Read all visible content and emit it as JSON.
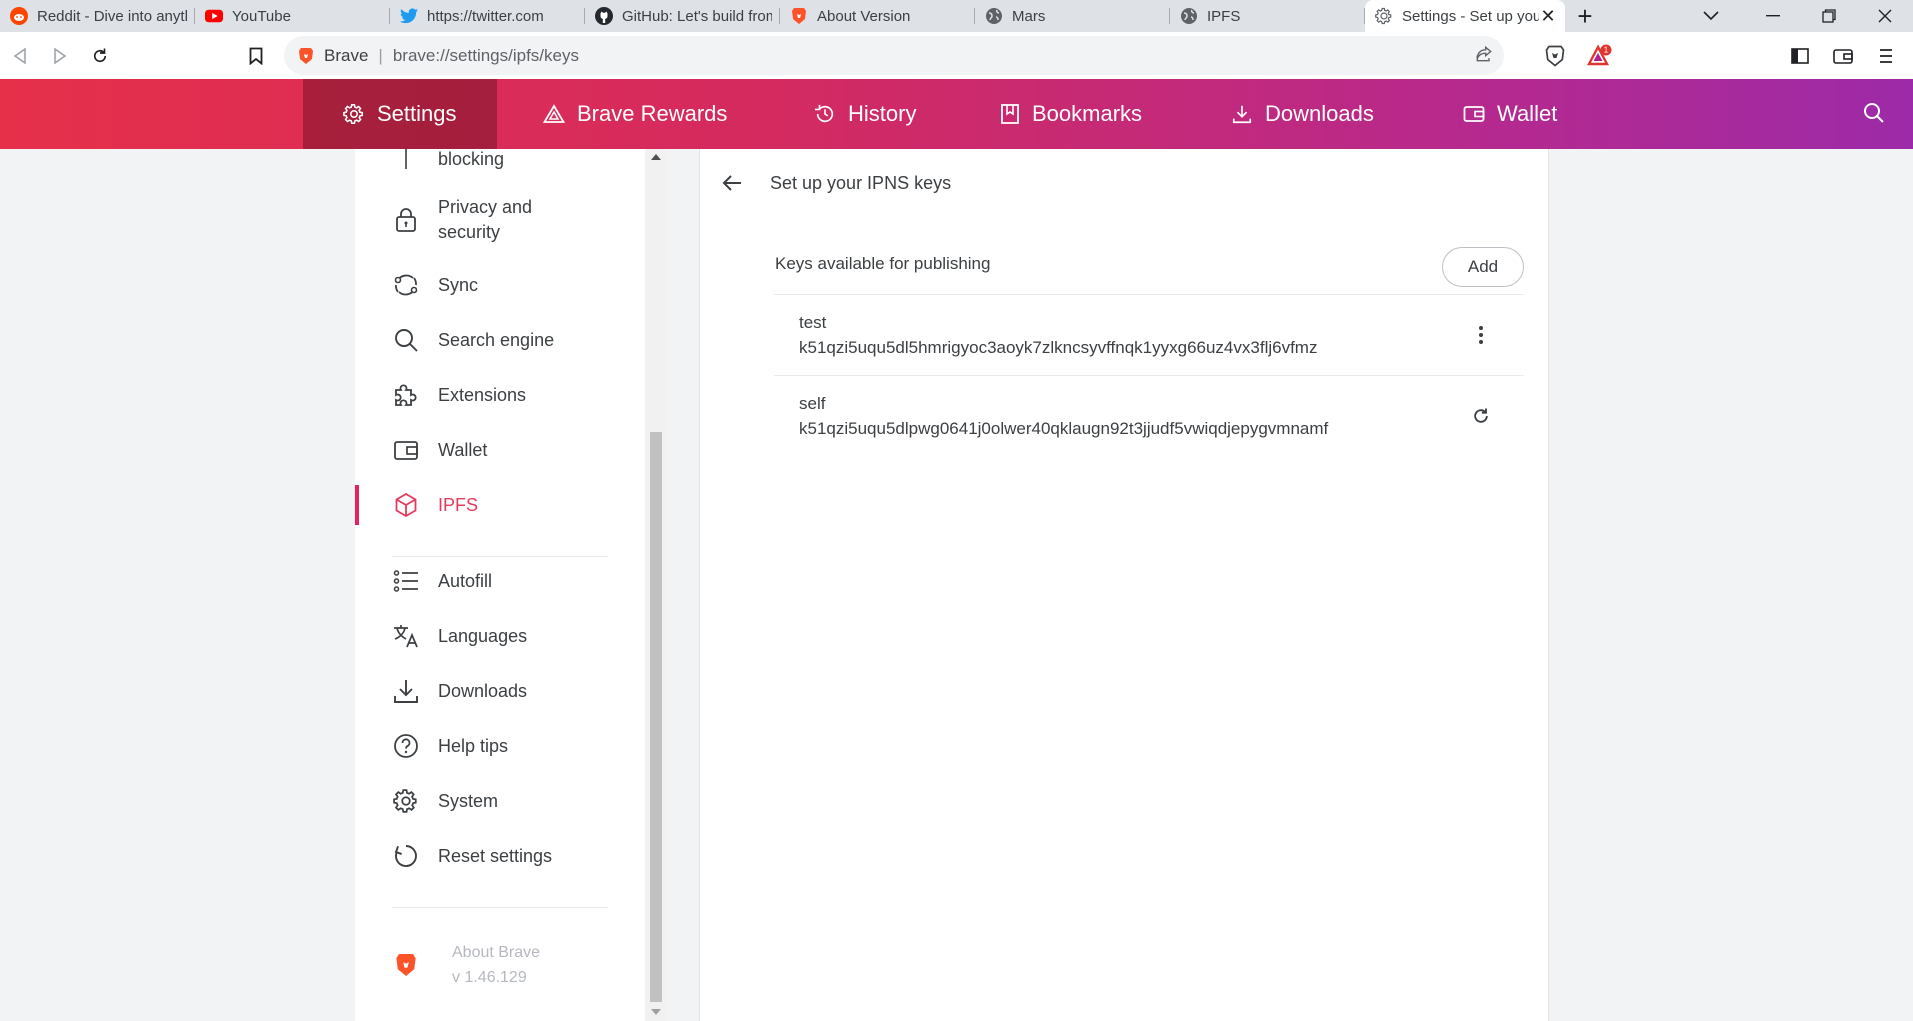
{
  "tabs": [
    {
      "title": "Reddit - Dive into anything",
      "icon": "reddit-icon",
      "color": "#ff4500"
    },
    {
      "title": "YouTube",
      "icon": "youtube-icon",
      "color": "#ff0000"
    },
    {
      "title": "https://twitter.com",
      "icon": "twitter-icon",
      "color": "#1d9bf0"
    },
    {
      "title": "GitHub: Let's build from here",
      "icon": "github-icon",
      "color": "#24292f"
    },
    {
      "title": "About Version",
      "icon": "brave-icon",
      "color": "#fb542b"
    },
    {
      "title": "Mars",
      "icon": "globe-icon",
      "color": "#5f6368"
    },
    {
      "title": "IPFS",
      "icon": "globe-icon",
      "color": "#5f6368"
    },
    {
      "title": "Settings - Set up your IPNS keys",
      "icon": "gear-icon",
      "color": "#5f6368"
    }
  ],
  "toolbar": {
    "site_label": "Brave",
    "url": "brave://settings/ipfs/keys",
    "rewards_badge": "1"
  },
  "navbar": {
    "items": [
      {
        "label": "Settings"
      },
      {
        "label": "Brave Rewards"
      },
      {
        "label": "History"
      },
      {
        "label": "Bookmarks"
      },
      {
        "label": "Downloads"
      },
      {
        "label": "Wallet"
      }
    ]
  },
  "sidebar": {
    "partial_item": "blocking",
    "items": [
      {
        "label": "Privacy and security"
      },
      {
        "label": "Sync"
      },
      {
        "label": "Search engine"
      },
      {
        "label": "Extensions"
      },
      {
        "label": "Wallet"
      },
      {
        "label": "IPFS"
      },
      {
        "label": "Autofill"
      },
      {
        "label": "Languages"
      },
      {
        "label": "Downloads"
      },
      {
        "label": "Help tips"
      },
      {
        "label": "System"
      },
      {
        "label": "Reset settings"
      }
    ],
    "about_title": "About Brave",
    "about_version": "v 1.46.129"
  },
  "main": {
    "title": "Set up your IPNS keys",
    "section_label": "Keys available for publishing",
    "add_label": "Add",
    "keys": [
      {
        "name": "test",
        "id": "k51qzi5uqu5dl5hmrigyoc3aoyk7zlkncsyvffnqk1yyxg66uz4vx3flj6vfmz",
        "action": "more-vert-icon"
      },
      {
        "name": "self",
        "id": "k51qzi5uqu5dlpwg0641j0olwer40qklaugn92t3jjudf5vwiqdjepygvmnamf",
        "action": "refresh-icon"
      }
    ]
  },
  "colors": {
    "accent": "#e8395d",
    "nav_gradient_start": "#e6304a",
    "nav_gradient_end": "#9d2aa8"
  }
}
